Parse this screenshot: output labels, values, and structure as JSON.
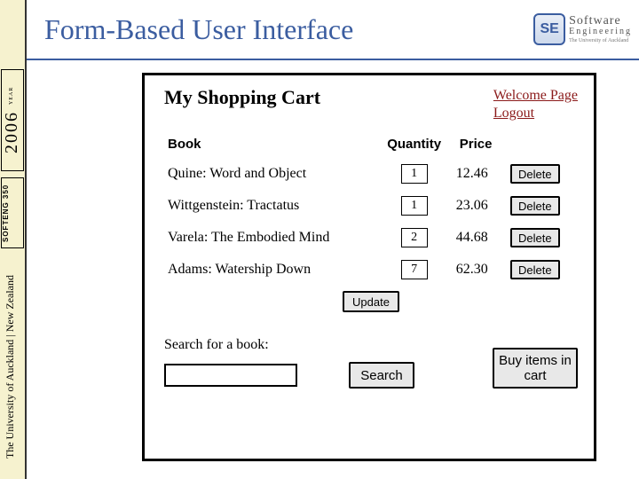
{
  "rail": {
    "year": "2006",
    "year_label": "YEAR",
    "course": "SOFTENG 350",
    "university": "The University of Auckland | New Zealand"
  },
  "title": "Form-Based User Interface",
  "logo": {
    "mark": "SE",
    "line1": "Software",
    "line2": "Engineering",
    "line3": "The University of Auckland"
  },
  "panel": {
    "heading": "My Shopping Cart",
    "links": {
      "welcome": "Welcome Page",
      "logout": "Logout"
    },
    "columns": {
      "book": "Book",
      "qty": "Quantity",
      "price": "Price"
    },
    "rows": [
      {
        "title": "Quine: Word and Object",
        "qty": "1",
        "price": "12.46",
        "delete": "Delete"
      },
      {
        "title": "Wittgenstein: Tractatus",
        "qty": "1",
        "price": "23.06",
        "delete": "Delete"
      },
      {
        "title": "Varela: The Embodied Mind",
        "qty": "2",
        "price": "44.68",
        "delete": "Delete"
      },
      {
        "title": "Adams: Watership Down",
        "qty": "7",
        "price": "62.30",
        "delete": "Delete"
      }
    ],
    "update": "Update",
    "search_label": "Search for a book:",
    "search_button": "Search",
    "buy_button": "Buy items in cart"
  }
}
